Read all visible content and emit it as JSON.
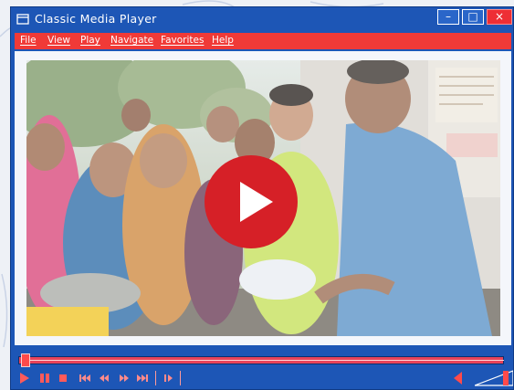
{
  "window": {
    "title": "Classic Media Player",
    "buttons": {
      "minimize": "–",
      "maximize": "□",
      "close": "×"
    }
  },
  "menu": [
    "File",
    "View",
    "Play",
    "Navigate",
    "Favorites",
    "Help"
  ],
  "player": {
    "progress": 0.01,
    "volume": 0.85
  },
  "colors": {
    "chrome": "#1d56b6",
    "menubar": "#f03a37",
    "accent": "#ee2e35",
    "play_button": "#d62027"
  },
  "icons": {
    "controls": [
      "play-icon",
      "pause-icon",
      "stop-icon",
      "skip-back-icon",
      "rewind-icon",
      "fast-forward-icon",
      "skip-forward-icon",
      "frame-step-icon"
    ],
    "volume": "speaker-icon"
  }
}
